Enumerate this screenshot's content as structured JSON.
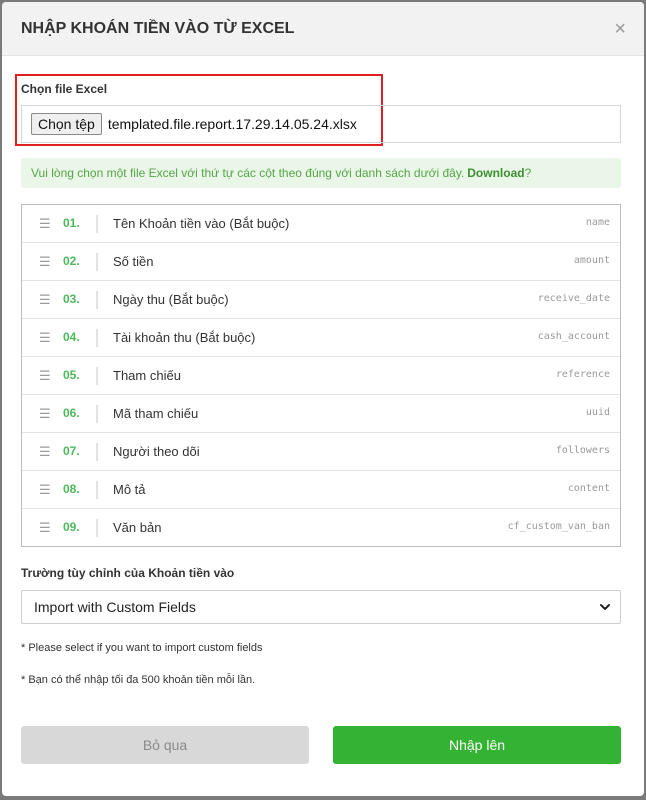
{
  "modal": {
    "title": "NHẬP KHOÁN TIỀN VÀO TỪ EXCEL",
    "close_icon": "×"
  },
  "file": {
    "label": "Chọn file Excel",
    "button_label": "Chọn tệp",
    "file_name": "templated.file.report.17.29.14.05.24.xlsx"
  },
  "info": {
    "text": "Vui lòng chọn một file Excel với thứ tự các cột theo đúng với danh sách dưới đây.",
    "download_label": "Download",
    "suffix": "?"
  },
  "fields": [
    {
      "num": "01.",
      "label": "Tên Khoản tiền vào (Bắt buộc)",
      "key": "name"
    },
    {
      "num": "02.",
      "label": "Số tiền",
      "key": "amount"
    },
    {
      "num": "03.",
      "label": "Ngày thu (Bắt buộc)",
      "key": "receive_date"
    },
    {
      "num": "04.",
      "label": "Tài khoản thu (Bắt buộc)",
      "key": "cash_account"
    },
    {
      "num": "05.",
      "label": "Tham chiếu",
      "key": "reference"
    },
    {
      "num": "06.",
      "label": "Mã tham chiếu",
      "key": "uuid"
    },
    {
      "num": "07.",
      "label": "Người theo dõi",
      "key": "followers"
    },
    {
      "num": "08.",
      "label": "Mô tả",
      "key": "content"
    },
    {
      "num": "09.",
      "label": "Văn bản",
      "key": "cf_custom_van_ban"
    }
  ],
  "custom_fields": {
    "label": "Trường tùy chỉnh của Khoản tiền vào",
    "selected": "Import with Custom Fields"
  },
  "notes": {
    "custom": "* Please select if you want to import custom fields",
    "limit": "* Bạn có thể nhập tối đa 500 khoản tiền mỗi lần."
  },
  "actions": {
    "skip_label": "Bỏ qua",
    "import_label": "Nhập lên"
  },
  "colors": {
    "accent_green": "#34b233",
    "number_green": "#4cb85c",
    "alert_bg": "#eaf6e8",
    "highlight_red": "#e02020"
  },
  "icons": {
    "drag": "drag-handle-icon",
    "close": "close-icon",
    "dropdown": "chevron-down-icon"
  }
}
